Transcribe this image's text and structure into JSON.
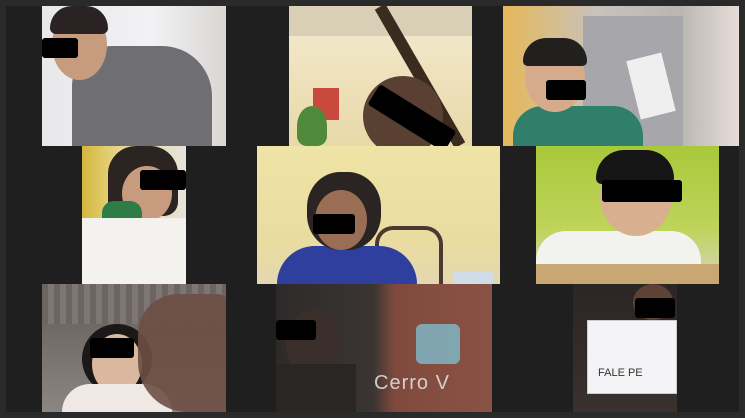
{
  "meeting": {
    "tiles": [
      {
        "label": ""
      },
      {
        "label": ""
      },
      {
        "label": ""
      },
      {
        "label": ""
      },
      {
        "label": ""
      },
      {
        "label": ""
      },
      {
        "label": ""
      },
      {
        "label": ""
      },
      {
        "label": ""
      }
    ],
    "background_brand_text": "Cerro V",
    "drawing_text": "FALE PE"
  },
  "colors": {
    "grid_background": "#1f1f1f",
    "censor_bar": "#000000"
  }
}
